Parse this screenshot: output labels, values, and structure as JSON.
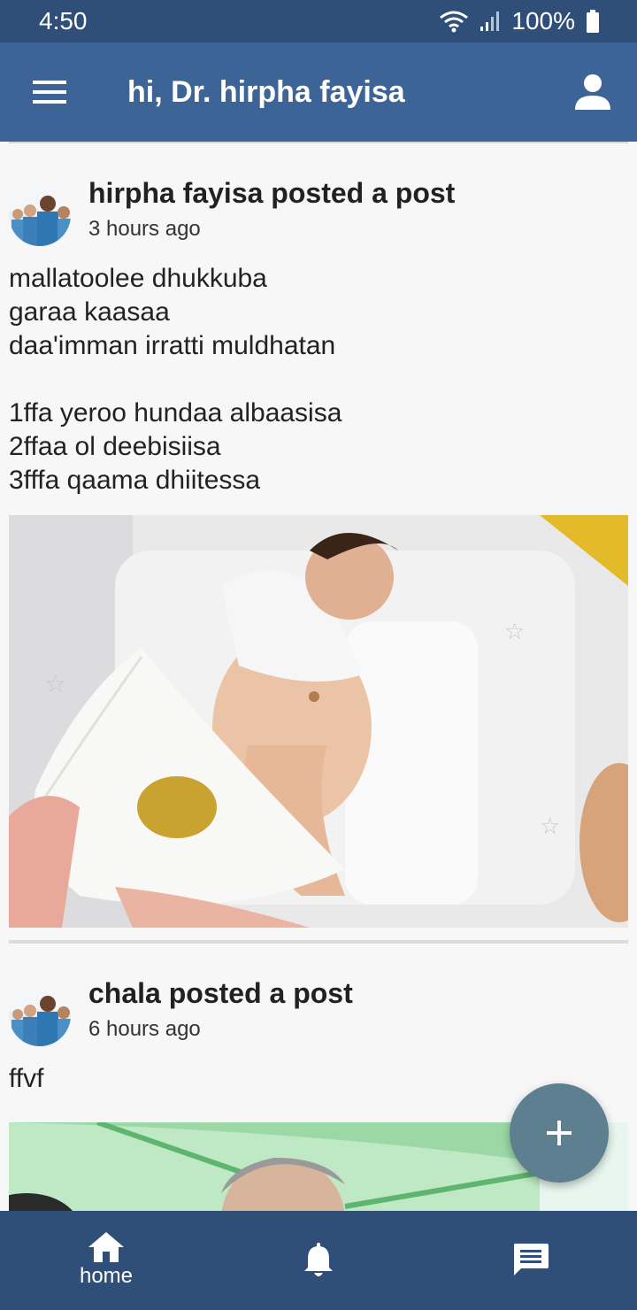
{
  "status_bar": {
    "time": "4:50",
    "battery": "100%"
  },
  "app_bar": {
    "title": "hi, Dr. hirpha fayisa",
    "color": "#3d6496"
  },
  "posts": [
    {
      "author_line": "hirpha fayisa posted a post",
      "time": "3 hours ago",
      "body": "mallatoolee dhukkuba\ngaraa kaasaa\ndaa'imman irratti muldhatan\n\n1ffa yeroo hundaa albaasisa\n2ffaa ol deebisiisa\n3fffa qaama dhiitessa"
    },
    {
      "author_line": "chala posted a post",
      "time": "6 hours ago",
      "body": "ffvf"
    }
  ],
  "fab": {
    "icon": "plus-icon"
  },
  "bottom_nav": {
    "home_label": "home",
    "items": [
      "home-icon",
      "bell-icon",
      "chat-icon"
    ]
  },
  "colors": {
    "status_bar": "#2f4f78",
    "fab": "#5e7f90",
    "background": "#f7f7f7"
  }
}
